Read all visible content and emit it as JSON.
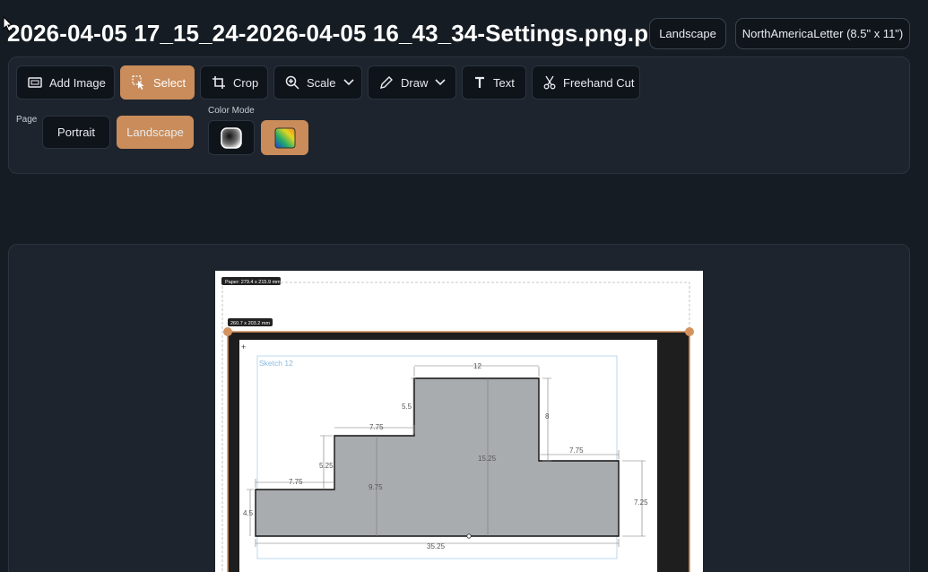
{
  "header": {
    "title": "2026-04-05 17_15_24-2026-04-05 16_43_34-Settings.png.png",
    "orientation_pill": "Landscape",
    "paper_size_pill": "NorthAmericaLetter (8.5\" x 11\")"
  },
  "toolbar": {
    "add_image": "Add Image",
    "select": "Select",
    "crop": "Crop",
    "scale": "Scale",
    "draw": "Draw",
    "text": "Text",
    "freehand_cut": "Freehand Cut"
  },
  "page": {
    "label": "Page",
    "portrait": "Portrait",
    "landscape": "Landscape",
    "selected": "Landscape"
  },
  "color_mode": {
    "label": "Color Mode",
    "options": [
      "grayscale-icon",
      "color-gradient-icon"
    ],
    "selected": "color-gradient-icon"
  },
  "canvas": {
    "paper_label": "Paper: 279.4 x 215.9 mm",
    "image_label": "260.7 x 203.2 mm",
    "sketch_title": "Sketch 12",
    "dimensions": {
      "top_width": "12",
      "right_step_height": "8",
      "upper_step_width": "7.75",
      "upper_step_height": "5.5",
      "middle_step_height": "5.25",
      "left_step_width": "7.75",
      "left_height": "4.5",
      "inner_height_left": "9.75",
      "inner_height_center": "15.25",
      "right_step_width": "7.75",
      "right_height": "7.25",
      "total_width": "35.25"
    }
  },
  "colors": {
    "accent": "#c98c5a",
    "background": "#161c24",
    "panel": "#1d242e",
    "button": "#0f141a"
  }
}
